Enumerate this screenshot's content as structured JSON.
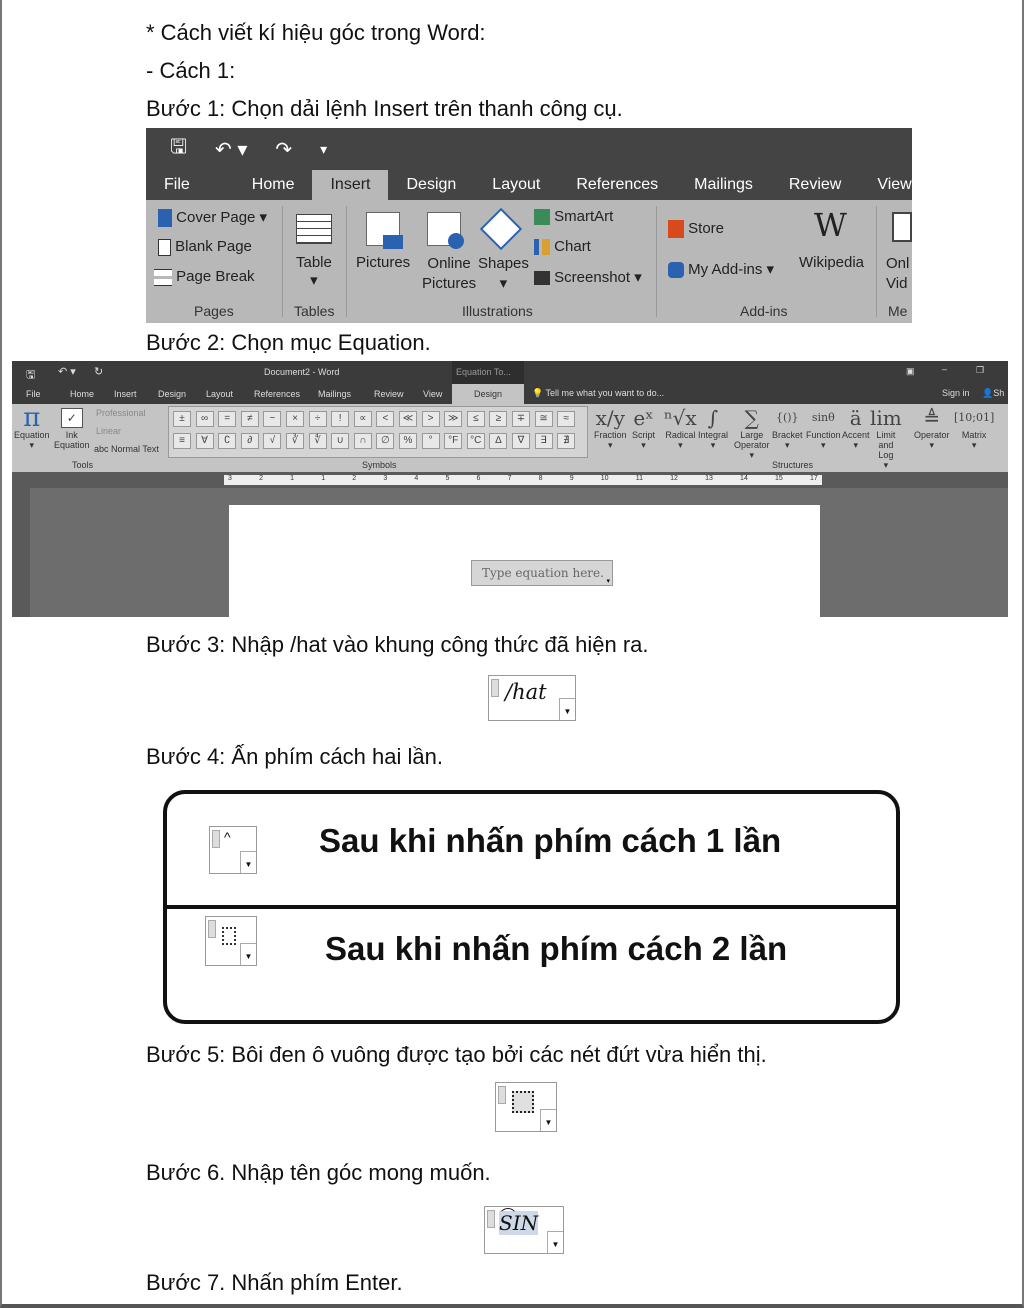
{
  "lines": {
    "title": "* Cách viết kí hiệu góc trong Word:",
    "method": " - Cách 1:",
    "step1": "Bước 1: Chọn dải lệnh Insert trên thanh công cụ.",
    "step2": "Bước 2: Chọn mục Equation.",
    "step3": "Bước 3: Nhập /hat vào khung công thức đã hiện ra.",
    "step4": "Bước 4: Ấn phím cách hai lần.",
    "step5": "Bước 5: Bôi đen ô vuông được tạo bởi các nét đứt vừa hiển thị.",
    "step6": "Bước 6. Nhập tên góc mong muốn.",
    "step7": "Bước 7. Nhấn phím Enter."
  },
  "ribbon1": {
    "tabs": [
      "File",
      "Home",
      "Insert",
      "Design",
      "Layout",
      "References",
      "Mailings",
      "Review",
      "View"
    ],
    "active_tab": "Insert",
    "pages": {
      "cover": "Cover Page",
      "blank": "Blank Page",
      "break": "Page Break",
      "group": "Pages"
    },
    "tables": {
      "table": "Table",
      "group": "Tables"
    },
    "illustrations": {
      "pictures": "Pictures",
      "online1": "Online",
      "online2": "Pictures",
      "shapes": "Shapes",
      "smartart": "SmartArt",
      "chart": "Chart",
      "screenshot": "Screenshot",
      "group": "Illustrations"
    },
    "addins": {
      "store": "Store",
      "myaddins": "My Add-ins",
      "wikipedia": "Wikipedia",
      "group": "Add-ins"
    },
    "media": {
      "l1": "Onl",
      "l2": "Vid",
      "group": "Me"
    }
  },
  "ribbon2": {
    "title": "Document2 - Word",
    "context_tab": "Equation To...",
    "tabs": [
      "File",
      "Home",
      "Insert",
      "Design",
      "Layout",
      "References",
      "Mailings",
      "Review",
      "View"
    ],
    "active_tab": "Design",
    "tell_me": "Tell me what you want to do...",
    "sign_in": "Sign in",
    "share": "Sh",
    "tools": {
      "equation": "Equation",
      "ink1": "Ink",
      "ink2": "Equation",
      "professional": "Professional",
      "linear": "Linear",
      "normal": "abc Normal Text",
      "group": "Tools"
    },
    "symbols_row1": [
      "±",
      "∞",
      "=",
      "≠",
      "~",
      "×",
      "÷",
      "!",
      "∝",
      "<",
      "≪",
      ">",
      "≫",
      "≤",
      "≥",
      "∓",
      "≅",
      "≈"
    ],
    "symbols_row2": [
      "≡",
      "∀",
      "∁",
      "∂",
      "√",
      "∛",
      "∜",
      "∪",
      "∩",
      "∅",
      "%",
      "°",
      "°F",
      "°C",
      "∆",
      "∇",
      "∃",
      "∄"
    ],
    "symbols_group": "Symbols",
    "structures": [
      {
        "glyph": "x/y",
        "label": "Fraction"
      },
      {
        "glyph": "eˣ",
        "label": "Script"
      },
      {
        "glyph": "ⁿ√x",
        "label": "Radical"
      },
      {
        "glyph": "∫",
        "label": "Integral"
      },
      {
        "glyph": "∑",
        "label": "Large Operator"
      },
      {
        "glyph": "{()}",
        "label": "Bracket"
      },
      {
        "glyph": "sinθ",
        "label": "Function"
      },
      {
        "glyph": "ä",
        "label": "Accent"
      },
      {
        "glyph": "lim",
        "label": "Limit and Log"
      },
      {
        "glyph": "≜",
        "label": "Operator"
      },
      {
        "glyph": "[10;01]",
        "label": "Matrix"
      }
    ],
    "structures_group": "Structures",
    "ruler": [
      "3",
      "2",
      "1",
      "1",
      "2",
      "3",
      "4",
      "5",
      "6",
      "7",
      "8",
      "9",
      "10",
      "11",
      "12",
      "13",
      "14",
      "15",
      "17"
    ],
    "placeholder": "Type equation here."
  },
  "step3_eq": "/hat",
  "box": {
    "row1": "Sau khi nhấn phím cách 1 lần",
    "row2": "Sau khi nhấn phím cách 2 lần"
  },
  "step6_eq": "SIN"
}
